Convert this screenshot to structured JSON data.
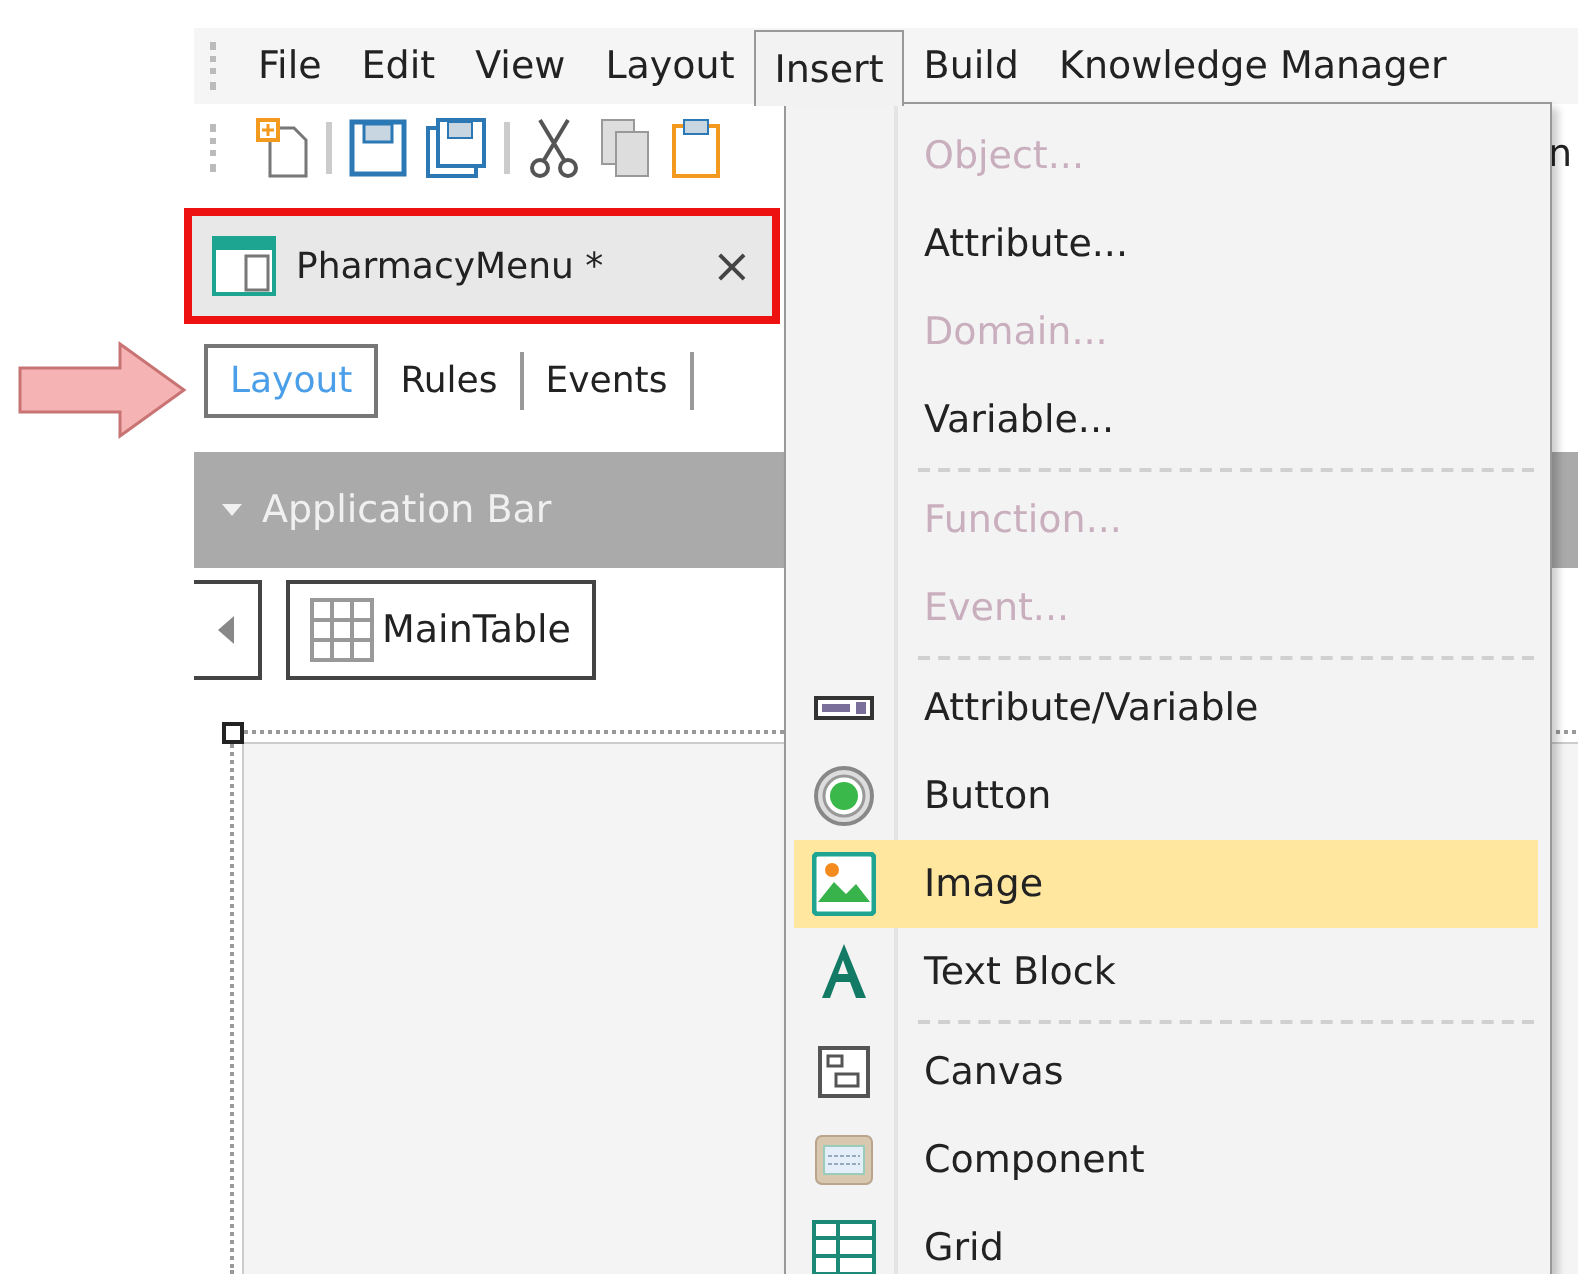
{
  "menu_bar": [
    {
      "label": "File",
      "selected": false
    },
    {
      "label": "Edit",
      "selected": false
    },
    {
      "label": "View",
      "selected": false
    },
    {
      "label": "Layout",
      "selected": false
    },
    {
      "label": "Insert",
      "selected": true
    },
    {
      "label": "Build",
      "selected": false
    },
    {
      "label": "Knowledge Manager",
      "selected": false
    }
  ],
  "toolbar": {
    "overflow_text": "n"
  },
  "document_tab": {
    "title": "PharmacyMenu",
    "modified_mark": "*",
    "close_symbol": "×",
    "highlighted": true
  },
  "view_tabs": [
    {
      "label": "Layout",
      "selected": true
    },
    {
      "label": "Rules",
      "selected": false
    },
    {
      "label": "Events",
      "selected": false
    }
  ],
  "application_bar": {
    "title": "Application Bar",
    "expanded": true
  },
  "breadcrumb": {
    "label": "MainTable"
  },
  "insert_menu": [
    {
      "kind": "item",
      "label": "Object...",
      "disabled": true,
      "selected": false
    },
    {
      "kind": "item",
      "label": "Attribute...",
      "disabled": false,
      "selected": false
    },
    {
      "kind": "item",
      "label": "Domain...",
      "disabled": true,
      "selected": false
    },
    {
      "kind": "item",
      "label": "Variable...",
      "disabled": false,
      "selected": false
    },
    {
      "kind": "separator"
    },
    {
      "kind": "item",
      "label": "Function...",
      "disabled": true,
      "selected": false
    },
    {
      "kind": "item",
      "label": "Event...",
      "disabled": true,
      "selected": false
    },
    {
      "kind": "separator"
    },
    {
      "kind": "item",
      "label": "Attribute/Variable",
      "disabled": false,
      "selected": false
    },
    {
      "kind": "item",
      "label": "Button",
      "disabled": false,
      "selected": false
    },
    {
      "kind": "item",
      "label": "Image",
      "disabled": false,
      "selected": true
    },
    {
      "kind": "item",
      "label": "Text Block",
      "disabled": false,
      "selected": false
    },
    {
      "kind": "separator"
    },
    {
      "kind": "item",
      "label": "Canvas",
      "disabled": false,
      "selected": false
    },
    {
      "kind": "item",
      "label": "Component",
      "disabled": false,
      "selected": false
    },
    {
      "kind": "item",
      "label": "Grid",
      "disabled": false,
      "selected": false
    }
  ]
}
